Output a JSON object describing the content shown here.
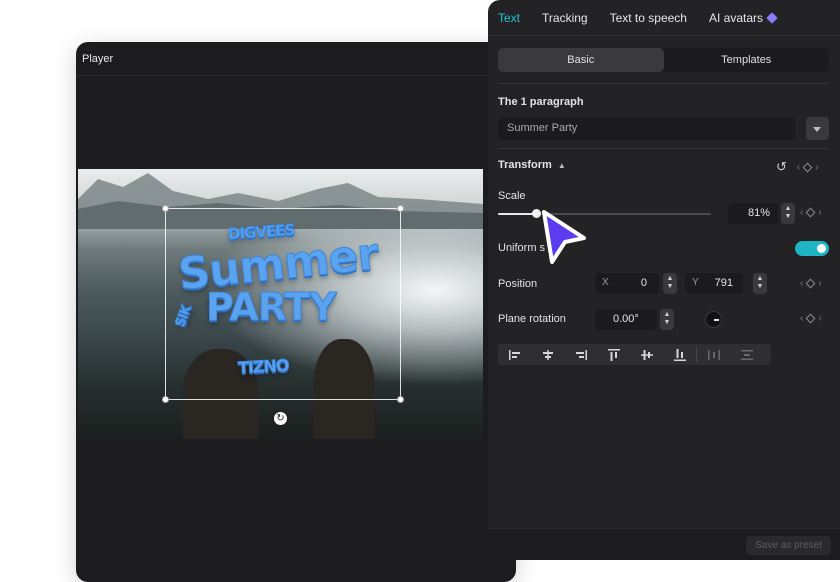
{
  "player": {
    "title": "Player",
    "sticker_lines": [
      "DIGVEES",
      "Summer",
      "PARTY",
      "TIZNO"
    ],
    "sticker_side": "SIK"
  },
  "panel": {
    "tabs": [
      {
        "label": "Text",
        "active": true
      },
      {
        "label": "Tracking",
        "active": false
      },
      {
        "label": "Text to speech",
        "active": false
      },
      {
        "label": "AI avatars",
        "active": false,
        "icon": "gem-icon"
      }
    ],
    "segments": [
      {
        "label": "Basic",
        "active": true
      },
      {
        "label": "Templates",
        "active": false
      }
    ],
    "paragraph_label": "The 1 paragraph",
    "paragraph_value": "Summer Party",
    "transform_label": "Transform",
    "scale": {
      "label": "Scale",
      "value_text": "81%",
      "value": 0.81,
      "slider_fraction": 0.18
    },
    "uniform_scale": {
      "label": "Uniform s",
      "on": true
    },
    "position": {
      "label": "Position",
      "x_label": "X",
      "x_value": "0",
      "y_label": "Y",
      "y_value": "791"
    },
    "plane_rotation": {
      "label": "Plane rotation",
      "value": "0.00°"
    },
    "save_preset": "Save as preset"
  },
  "colors": {
    "accent": "#22c4d2",
    "toggle": "#1fb5c4",
    "cursor": "#5b3cf0",
    "sticker": "#5aa3ef"
  }
}
